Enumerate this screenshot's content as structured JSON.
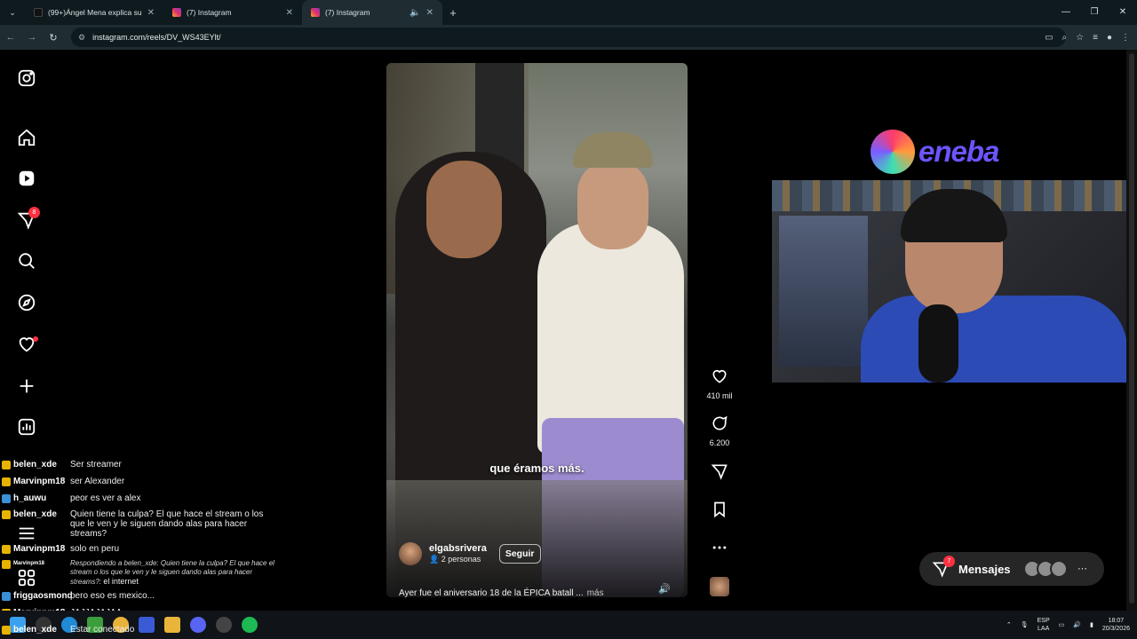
{
  "browser": {
    "tabs": [
      {
        "title": "(99+)Ángel Mena explica su ex",
        "active": false
      },
      {
        "title": "(7) Instagram",
        "active": false
      },
      {
        "title": "(7) Instagram",
        "active": true
      }
    ],
    "new_tab": "+",
    "url": "instagram.com/reels/DV_WS43EYlt/"
  },
  "sidebar": {
    "notifications_badge": "8",
    "icons": [
      "instagram-logo-icon",
      "home-icon",
      "reels-icon",
      "direct-icon",
      "search-icon",
      "explore-icon",
      "heart-icon",
      "create-icon",
      "dashboard-icon",
      "menu-icon",
      "apps-icon"
    ]
  },
  "reel": {
    "subtitle": "que éramos más.",
    "author": "elgabsrivera",
    "people": "2 personas",
    "follow": "Seguir",
    "caption": "Ayer fue el aniversario 18 de la ÉPICA batall ...",
    "more": "más",
    "likes": "410 mil",
    "comments": "6.200"
  },
  "overlay": {
    "brand": "eneba"
  },
  "messages": {
    "label": "Mensajes",
    "badge": "7"
  },
  "chat": [
    {
      "user": "belen_xde",
      "text": "Ser streamer",
      "badge": "gold"
    },
    {
      "user": "Marvinpm18",
      "text": "ser Alexander",
      "badge": "gold"
    },
    {
      "user": "h_auwu",
      "text": "peor es ver a alex",
      "badge": "blue"
    },
    {
      "user": "belen_xde",
      "text": "Quien tiene la culpa? El que hace el stream o los que le ven y le siguen dando alas para hacer streams?",
      "badge": "gold"
    },
    {
      "user": "Marvinpm18",
      "text": "solo en peru",
      "badge": "gold"
    },
    {
      "user": "Marvinpm18",
      "text": "Respondiendo a belen_xde: Quien tiene la culpa? El que hace el stream o los que le ven y le siguen dando alas para hacer streams?:",
      "reply_tail": "el internet",
      "badge": "gold"
    },
    {
      "user": "friggaosmond",
      "text": "pero eso es mexico...",
      "badge": "blue"
    },
    {
      "user": "Marvinpm18",
      "text": "JAJJAJAJAA",
      "badge": "gold"
    },
    {
      "user": "belen_xde",
      "text": "Estar conectado",
      "badge": "gold"
    }
  ],
  "tray": {
    "lang": "ESP",
    "layout": "LAA",
    "time": "18:07",
    "date": "20/3/2026"
  }
}
